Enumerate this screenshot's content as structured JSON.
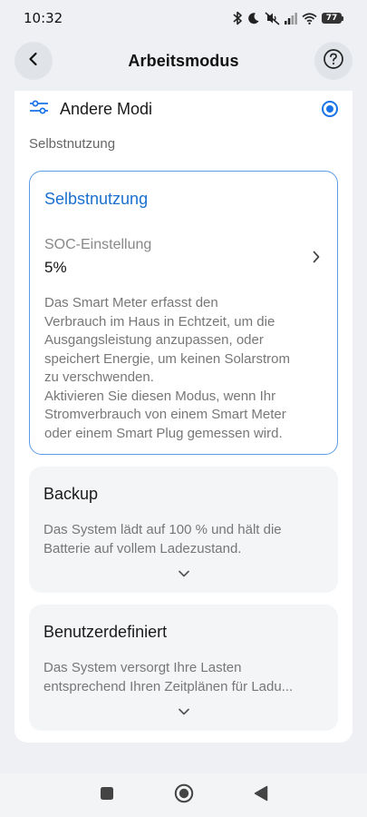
{
  "status_bar": {
    "time": "10:32",
    "battery": "77",
    "icons": [
      "bluetooth-icon",
      "moon-icon",
      "mute-icon",
      "signal-icon",
      "wifi-icon",
      "battery-icon"
    ]
  },
  "header": {
    "title": "Arbeitsmodus",
    "back_icon": "chevron-left-icon",
    "help_icon": "question-icon"
  },
  "mode": {
    "label": "Andere Modi",
    "icon": "sliders-icon",
    "selected": true,
    "accent_color": "#1a73e8"
  },
  "section_label": "Selbstnutzung",
  "options": [
    {
      "title": "Selbstnutzung",
      "active": true,
      "soc_label": "SOC-Einstellung",
      "soc_value": "5%",
      "description_lines": [
        "Das Smart Meter erfasst den",
        "Verbrauch im Haus in Echtzeit, um die",
        "Ausgangsleistung anzupassen, oder",
        "speichert Energie, um keinen Solarstrom",
        "zu verschwenden.",
        "Aktivieren Sie diesen Modus, wenn Ihr",
        "Stromverbrauch von einem Smart Meter",
        "oder einem Smart Plug gemessen wird."
      ]
    },
    {
      "title": "Backup",
      "active": false,
      "description_lines": [
        "Das System lädt auf 100 % und hält die",
        "Batterie auf vollem Ladezustand."
      ]
    },
    {
      "title": "Benutzerdefiniert",
      "active": false,
      "description_lines": [
        "Das System versorgt Ihre Lasten",
        "entsprechend Ihren Zeitplänen für Ladu..."
      ]
    }
  ],
  "nav_bar": {
    "icons": [
      "square-recents-icon",
      "circle-home-icon",
      "triangle-back-icon"
    ]
  }
}
